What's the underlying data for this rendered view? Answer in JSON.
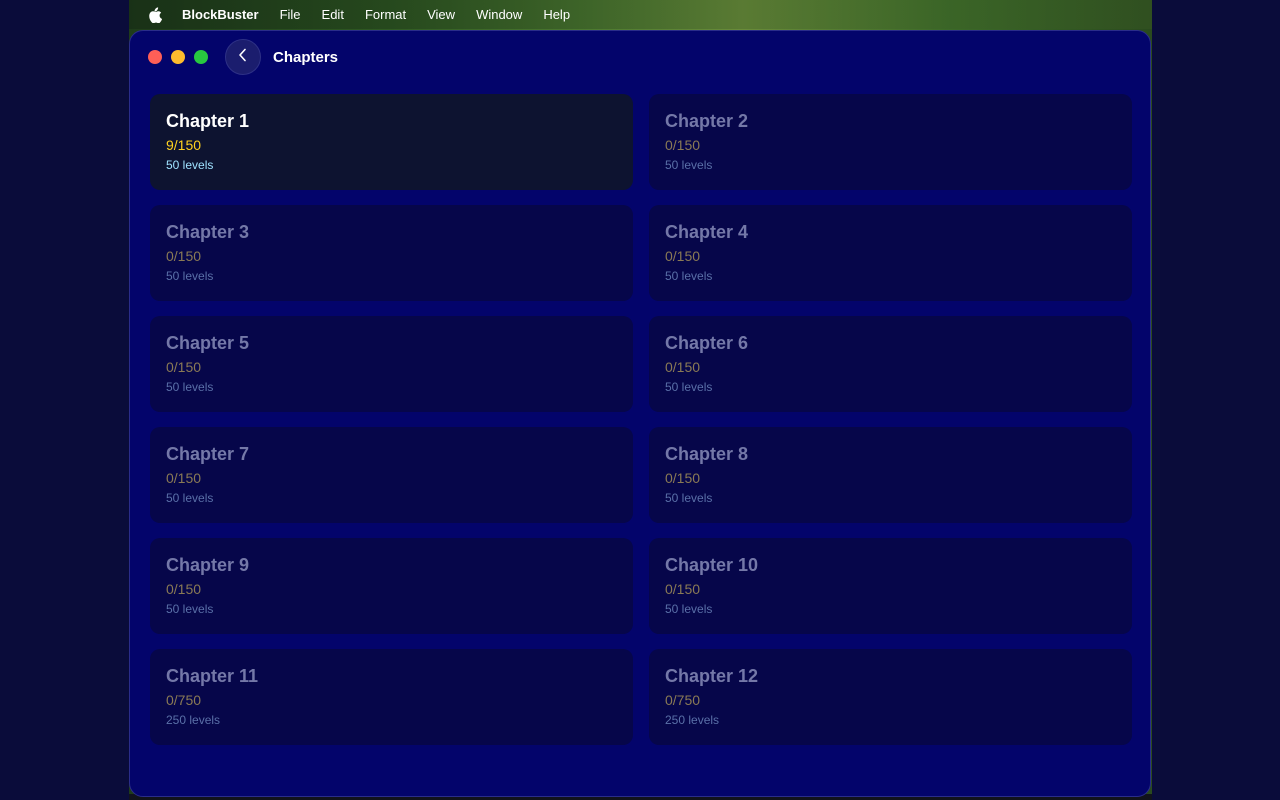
{
  "menubar": {
    "app_name": "BlockBuster",
    "items": [
      "File",
      "Edit",
      "Format",
      "View",
      "Window",
      "Help"
    ]
  },
  "window": {
    "title": "Chapters"
  },
  "chapters": [
    {
      "title": "Chapter 1",
      "progress": "9/150",
      "levels": "50 levels",
      "active": true
    },
    {
      "title": "Chapter 2",
      "progress": "0/150",
      "levels": "50 levels",
      "active": false
    },
    {
      "title": "Chapter 3",
      "progress": "0/150",
      "levels": "50 levels",
      "active": false
    },
    {
      "title": "Chapter 4",
      "progress": "0/150",
      "levels": "50 levels",
      "active": false
    },
    {
      "title": "Chapter 5",
      "progress": "0/150",
      "levels": "50 levels",
      "active": false
    },
    {
      "title": "Chapter 6",
      "progress": "0/150",
      "levels": "50 levels",
      "active": false
    },
    {
      "title": "Chapter 7",
      "progress": "0/150",
      "levels": "50 levels",
      "active": false
    },
    {
      "title": "Chapter 8",
      "progress": "0/150",
      "levels": "50 levels",
      "active": false
    },
    {
      "title": "Chapter 9",
      "progress": "0/150",
      "levels": "50 levels",
      "active": false
    },
    {
      "title": "Chapter 10",
      "progress": "0/150",
      "levels": "50 levels",
      "active": false
    },
    {
      "title": "Chapter 11",
      "progress": "0/750",
      "levels": "250 levels",
      "active": false
    },
    {
      "title": "Chapter 12",
      "progress": "0/750",
      "levels": "250 levels",
      "active": false
    }
  ],
  "colors": {
    "window_bg": "#03046b",
    "active_progress": "#ffd21f",
    "active_levels": "#9fe2ff"
  }
}
